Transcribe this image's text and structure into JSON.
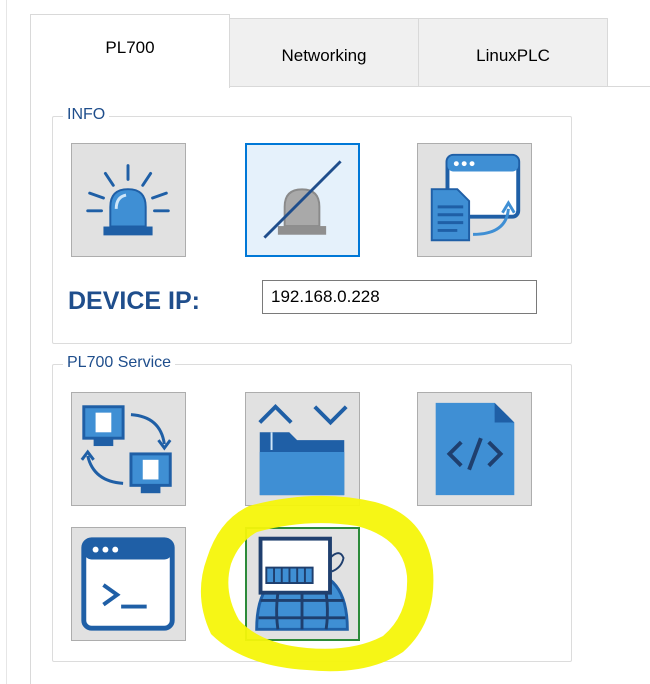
{
  "tabs": [
    {
      "label": "PL700",
      "active": true
    },
    {
      "label": "Networking",
      "active": false
    },
    {
      "label": "LinuxPLC",
      "active": false
    }
  ],
  "info_group": {
    "legend": "INFO",
    "buttons": [
      {
        "icon": "beacon-icon"
      },
      {
        "icon": "beacon-off-icon",
        "selected": true
      },
      {
        "icon": "window-document-export-icon"
      }
    ],
    "device_ip_label": "DEVICE IP:",
    "device_ip_value": "192.168.0.228"
  },
  "service_group": {
    "legend": "PL700 Service",
    "buttons": [
      {
        "icon": "computer-sync-icon"
      },
      {
        "icon": "folder-updown-icon"
      },
      {
        "icon": "code-file-icon"
      },
      {
        "icon": "terminal-window-icon"
      },
      {
        "icon": "web-device-globe-icon",
        "annotated": true
      }
    ]
  },
  "colors": {
    "accent": "#1f5fa6",
    "icon_blue": "#3f8fd4",
    "selection_border": "#0078d7",
    "highlight_annotation": "#f5f50a",
    "green_border": "#2c8a3a"
  }
}
